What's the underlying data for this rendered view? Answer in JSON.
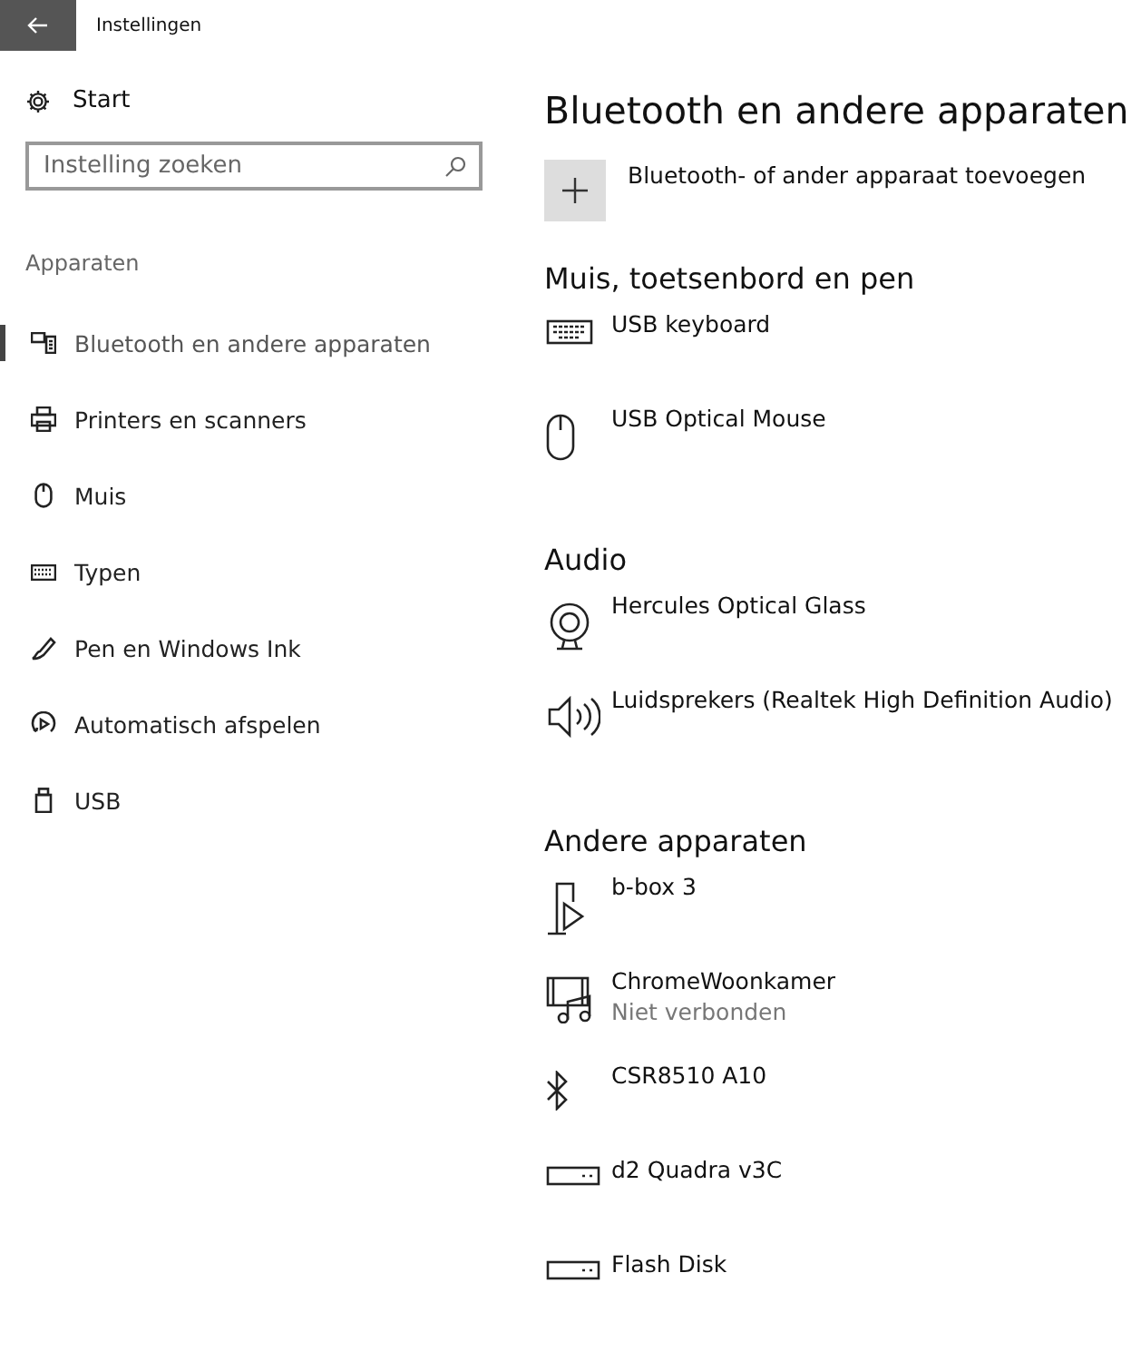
{
  "window": {
    "title": "Instellingen"
  },
  "sidebar": {
    "home": "Start",
    "search": {
      "placeholder": "Instelling zoeken"
    },
    "section": "Apparaten",
    "items": [
      {
        "label": "Bluetooth en andere apparaten",
        "kind": "devices",
        "selected": true
      },
      {
        "label": "Printers en scanners",
        "kind": "printer",
        "selected": false
      },
      {
        "label": "Muis",
        "kind": "mouse",
        "selected": false
      },
      {
        "label": "Typen",
        "kind": "keyboard",
        "selected": false
      },
      {
        "label": "Pen en Windows Ink",
        "kind": "pen",
        "selected": false
      },
      {
        "label": "Automatisch afspelen",
        "kind": "autoplay",
        "selected": false
      },
      {
        "label": "USB",
        "kind": "usb",
        "selected": false
      }
    ]
  },
  "main": {
    "title": "Bluetooth en andere apparaten",
    "add_button": "Bluetooth- of ander apparaat toevoegen",
    "sections": [
      {
        "title": "Muis, toetsenbord en pen",
        "devices": [
          {
            "name": "USB keyboard",
            "kind": "keyboard"
          },
          {
            "name": "USB Optical Mouse",
            "kind": "mouse"
          }
        ]
      },
      {
        "title": "Audio",
        "devices": [
          {
            "name": "Hercules Optical Glass",
            "kind": "webcam"
          },
          {
            "name": "Luidsprekers (Realtek High Definition Audio)",
            "kind": "speaker"
          }
        ]
      },
      {
        "title": "Andere apparaten",
        "devices": [
          {
            "name": "b-box 3",
            "kind": "media-player"
          },
          {
            "name": "ChromeWoonkamer",
            "kind": "media-stream",
            "status": "Niet verbonden"
          },
          {
            "name": "CSR8510 A10",
            "kind": "bluetooth"
          },
          {
            "name": "d2 Quadra v3C",
            "kind": "drive"
          },
          {
            "name": "Flash Disk",
            "kind": "drive"
          }
        ]
      }
    ]
  }
}
